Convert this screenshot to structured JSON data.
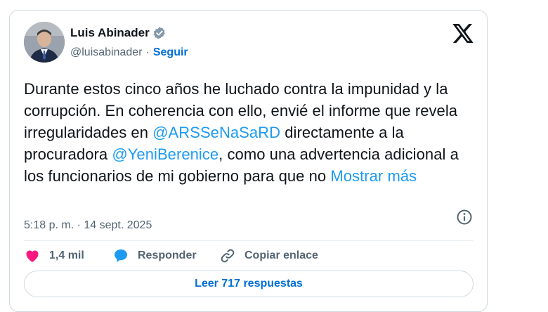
{
  "author": {
    "name": "Luis Abinader",
    "handle": "@luisabinader",
    "separator": "·",
    "follow_label": "Seguir"
  },
  "tweet": {
    "text_1": "Durante estos cinco años he luchado contra la impunidad y la corrupción. En coherencia con ello, envié el informe que revela irregularidades en ",
    "mention_1": "@ARSSeNaSaRD",
    "text_2": " directamente a la procuradora ",
    "mention_2": "@YeniBerenice",
    "text_3": ", como una advertencia adicional a los funcionarios de mi gobierno para que no ",
    "show_more": "Mostrar más",
    "timestamp": "5:18 p. m. · 14 sept. 2025"
  },
  "actions": {
    "likes_count": "1,4 mil",
    "reply_label": "Responder",
    "copy_link_label": "Copiar enlace"
  },
  "read_replies_label": "Leer 717 respuestas",
  "icons": {
    "verified": "verified-badge-icon",
    "logo": "x-logo-icon",
    "info": "info-icon",
    "like": "heart-icon",
    "reply": "speech-bubble-icon",
    "link": "link-icon"
  },
  "colors": {
    "accent_link": "#1d9bf0",
    "follow": "#006fd6",
    "heart": "#f91880",
    "text": "#0f1419",
    "muted": "#536471"
  }
}
